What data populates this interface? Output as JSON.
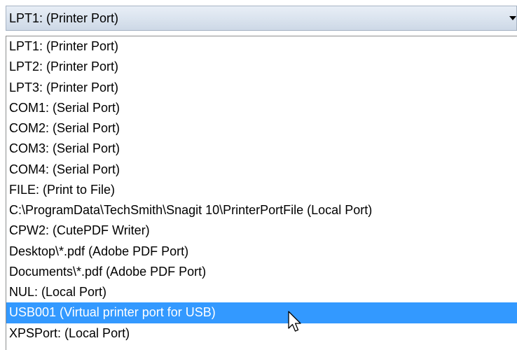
{
  "combo": {
    "selected_value": "LPT1: (Printer Port)",
    "arrow_icon": "dropdown-arrow-icon"
  },
  "list": {
    "selected_index": 13,
    "items": [
      "LPT1: (Printer Port)",
      "LPT2: (Printer Port)",
      "LPT3: (Printer Port)",
      "COM1: (Serial Port)",
      "COM2: (Serial Port)",
      "COM3: (Serial Port)",
      "COM4: (Serial Port)",
      "FILE: (Print to File)",
      "C:\\ProgramData\\TechSmith\\Snagit 10\\PrinterPortFile (Local Port)",
      "CPW2: (CutePDF Writer)",
      "Desktop\\*.pdf (Adobe PDF Port)",
      "Documents\\*.pdf (Adobe PDF Port)",
      "NUL: (Local Port)",
      "USB001 (Virtual printer port for USB)",
      "XPSPort: (Local Port)"
    ]
  },
  "pointer": {
    "icon": "mouse-pointer-icon"
  },
  "colors": {
    "highlight": "#3399ff",
    "highlight_text": "#ffffff"
  }
}
